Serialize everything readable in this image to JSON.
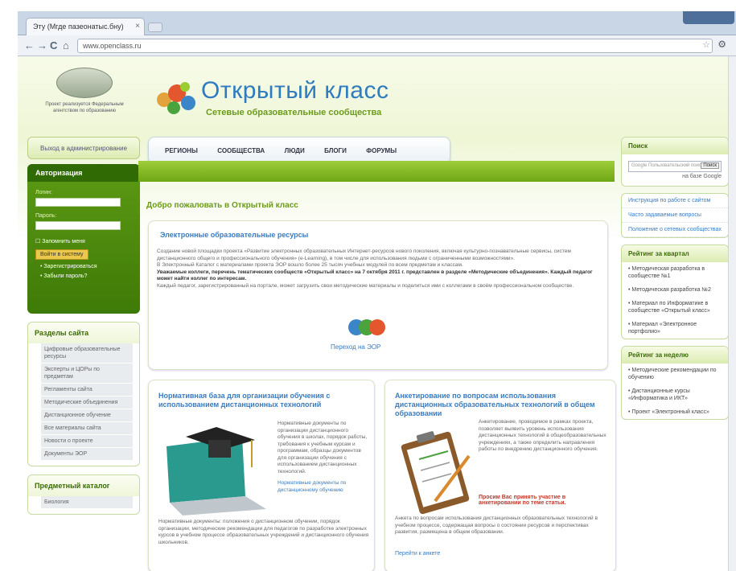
{
  "browser": {
    "tab_title": "Эту (Мгде пазеонатыс.бну)",
    "address": "www.openclass.ru",
    "back": "←",
    "forward": "→",
    "reload": "C",
    "home": "⌂",
    "star": "☆",
    "wrench": "⚙",
    "close": "×"
  },
  "header": {
    "logo_caption": "Проект реализуется Федеральным агентством по образованию",
    "title": "Открытый класс",
    "subtitle": "Сетевые образовательные сообщества"
  },
  "nav": {
    "items": [
      "РЕГИОНЫ",
      "СООБЩЕСТВА",
      "ЛЮДИ",
      "БЛОГИ",
      "ФОРУМЫ"
    ]
  },
  "left": {
    "enter_label": "Выход в администрирование",
    "auth": {
      "title": "Авторизация",
      "login_label": "Логин:",
      "password_label": "Пароль:",
      "remember": "Запомнить меня",
      "login_button": "Войти в систему",
      "register": "Зарегистрироваться",
      "forgot": "Забыли пароль?"
    },
    "sections": {
      "title": "Разделы сайта",
      "items": [
        "Цифровые образовательные ресурсы",
        "Эксперты и ЦОРы по предметам",
        "Регламенты сайта",
        "Методические объединения",
        "Дистанционное обучение",
        "Все материалы сайта",
        "Новости о проекте",
        "Документы ЭОР"
      ]
    },
    "catalog_title": "Предметный каталог",
    "catalog_item": "Биология"
  },
  "main": {
    "welcome": "Добро пожаловать в Открытый класс",
    "eor": {
      "title": "Электронные образовательные ресурсы",
      "text1": "Создание новой площадки проекта «Развитие электронных образовательных Интернет-ресурсов нового поколения, включая культурно-познавательные сервисы, систем дистанционного общего и профессионального обучения» (е-Learning), в том числе для использования людьми с ограниченными возможностями».",
      "text2": "В Электронный Каталог с материалами проекта ЭОР вошло более 25 тысяч учебных модулей по всем предметам и классам.",
      "text3": "Уважаемые коллеги, перечень тематических сообществ «Открытый класс» на 7 октября 2011 г. представлен в разделе «Методические объединения». Каждый педагог может найти коллег по интересам.",
      "text4": "Каждый педагог, зарегистрированный на портале, может загрузить свои методические материалы и поделиться ими с коллегами в своём профессиональном сообществе.",
      "link": "Переход на ЭОР",
      "logo": "ЭОР"
    },
    "left_card": {
      "title": "Нормативная база для организации обучения с использованием дистанционных технологий",
      "text": "Нормативные документы по организации дистанционного обучения в школах, порядок работы, требования к учебным курсам и программам, образцы документов для организации обучения с использованием дистанционных технологий.",
      "subtitle": "Нормативные документы по дистанционному обучению",
      "bottom": "Нормативные документы: положения о дистанционном обучении, порядок организации, методические рекомендации для педагогов по разработке электронных курсов в учебном процессе образовательных учреждений и дистанционного обучения школьников."
    },
    "right_card": {
      "title": "Анкетирование по вопросам использования дистанционных образовательных технологий в общем образовании",
      "text": "Анкетирование, проводимое в рамках проекта, позволяет выявить уровень использования дистанционных технологий в общеобразовательных учреждениях, а также определить направления работы по внедрению дистанционного обучения.",
      "red": "Просим Вас принять участие в анкетировании по теме статьи.",
      "bottom": "Анкета по вопросам использования дистанционных образовательных технологий в учебном процессе, содержащая вопросы о состоянии ресурсов и перспективах развития, размещена в общем образовании.",
      "link": "Перейти к анкете"
    }
  },
  "right": {
    "search": {
      "title": "Поиск",
      "placeholder": "Google Пользовательский поиск",
      "button": "Поиск",
      "powered": "на базе Google"
    },
    "links": [
      "Инструкция по работе с сайтом",
      "Часто задаваемые вопросы",
      "Положение о сетевых сообществах"
    ],
    "rating_box": {
      "title": "Рейтинг за квартал",
      "items": [
        "Методическая разработка в сообществе №1",
        "Методическая разработка №2",
        "Материал по Информатике в сообществе «Открытый класс»",
        "Материал «Электронное портфолио»"
      ]
    },
    "week_box": {
      "title": "Рейтинг за неделю",
      "items": [
        "Методические рекомендации по обучению",
        "Дистанционные курсы «Информатика и ИКТ»",
        "Проект «Электронный класс»"
      ]
    }
  }
}
